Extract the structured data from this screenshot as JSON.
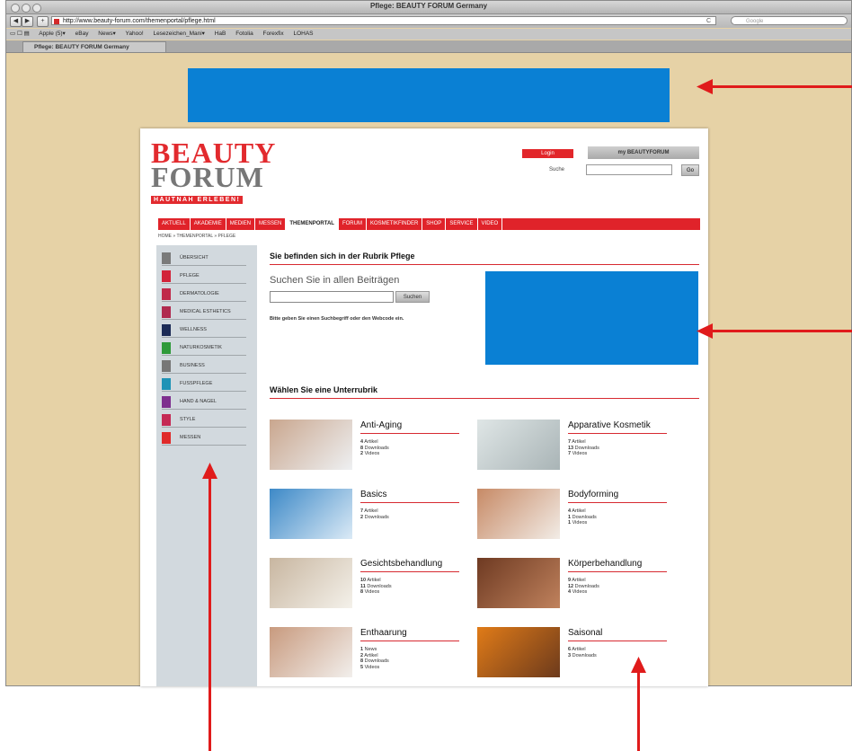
{
  "browser": {
    "window_title": "Pflege: BEAUTY FORUM Germany",
    "url": "http://www.beauty-forum.com/themenportal/pflege.html",
    "search_placeholder": "Google",
    "reload_glyph": "C",
    "bookmarks": [
      "Apple (5)▾",
      "eBay",
      "News▾",
      "Yahoo!",
      "Lesezeichen_Mani▾",
      "HaB",
      "Fotolia",
      "Forexfix",
      "LOHAS"
    ],
    "tab_title": "Pflege: BEAUTY FORUM Germany"
  },
  "header": {
    "logo_line1": "BEAUTY",
    "logo_line2": "FORUM",
    "logo_tagline": "HAUTNAH ERLEBEN!",
    "login_label": "Login",
    "my_label": "my BEAUTYFORUM",
    "search_label": "Suche",
    "go_label": "Go"
  },
  "nav": {
    "items": [
      "AKTUELL",
      "AKADEMIE",
      "MEDIEN",
      "MESSEN",
      "THEMENPORTAL",
      "FORUM",
      "KOSMETIKFINDER",
      "SHOP",
      "SERVICE",
      "VIDEO"
    ],
    "active": "THEMENPORTAL"
  },
  "breadcrumb": "HOME » THEMENPORTAL » PFLEGE",
  "sidebar": {
    "items": [
      {
        "label": "ÜBERSICHT",
        "color": "#7a7a7a"
      },
      {
        "label": "PFLEGE",
        "color": "#d2243a"
      },
      {
        "label": "DERMATOLOGIE",
        "color": "#c02a4a"
      },
      {
        "label": "MEDICAL ESTHETICS",
        "color": "#b02a4f"
      },
      {
        "label": "WELLNESS",
        "color": "#1c2b56"
      },
      {
        "label": "NATURKOSMETIK",
        "color": "#2f9a3a"
      },
      {
        "label": "BUSINESS",
        "color": "#777777"
      },
      {
        "label": "FUSSPFLEGE",
        "color": "#1f93b6"
      },
      {
        "label": "HAND & NAGEL",
        "color": "#7e2f8e"
      },
      {
        "label": "STYLE",
        "color": "#c52a55"
      },
      {
        "label": "MESSEN",
        "color": "#e02a2a"
      }
    ]
  },
  "main": {
    "rubrik_title": "Sie befinden sich in der Rubrik Pflege",
    "search_heading": "Suchen Sie in allen Beiträgen",
    "search_button": "Suchen",
    "search_hint": "Bitte geben Sie einen Suchbegriff oder den Webcode ein.",
    "unterrubrik_title": "Wählen Sie eine Unterrubrik"
  },
  "categories": [
    {
      "title": "Anti-Aging",
      "stats": [
        [
          "4",
          "Artikel"
        ],
        [
          "8",
          "Downloads"
        ],
        [
          "2",
          "Videos"
        ]
      ],
      "img": [
        "#c9a68e",
        "#eef0f2"
      ]
    },
    {
      "title": "Apparative Kosmetik",
      "stats": [
        [
          "7",
          "Artikel"
        ],
        [
          "13",
          "Downloads"
        ],
        [
          "7",
          "Videos"
        ]
      ],
      "img": [
        "#dfe6e6",
        "#a9b4b6"
      ]
    },
    {
      "title": "Basics",
      "stats": [
        [
          "7",
          "Artikel"
        ],
        [
          "2",
          "Downloads"
        ]
      ],
      "img": [
        "#3d89c7",
        "#dbeaf6"
      ]
    },
    {
      "title": "Bodyforming",
      "stats": [
        [
          "4",
          "Artikel"
        ],
        [
          "1",
          "Downloads"
        ],
        [
          "1",
          "Videos"
        ]
      ],
      "img": [
        "#c78a66",
        "#f2ece6"
      ]
    },
    {
      "title": "Gesichtsbehandlung",
      "stats": [
        [
          "10",
          "Artikel"
        ],
        [
          "11",
          "Downloads"
        ],
        [
          "8",
          "Videos"
        ]
      ],
      "img": [
        "#c8b6a0",
        "#f4f1ea"
      ]
    },
    {
      "title": "Körperbehandlung",
      "stats": [
        [
          "9",
          "Artikel"
        ],
        [
          "12",
          "Downloads"
        ],
        [
          "4",
          "Videos"
        ]
      ],
      "img": [
        "#6e3a22",
        "#c0825d"
      ]
    },
    {
      "title": "Enthaarung",
      "stats": [
        [
          "1",
          "News"
        ],
        [
          "2",
          "Artikel"
        ],
        [
          "8",
          "Downloads"
        ],
        [
          "5",
          "Videos"
        ]
      ],
      "img": [
        "#c89a7e",
        "#f2efec"
      ]
    },
    {
      "title": "Saisonal",
      "stats": [
        [
          "6",
          "Artikel"
        ],
        [
          "3",
          "Downloads"
        ]
      ],
      "img": [
        "#e07b18",
        "#6c3a1c"
      ]
    }
  ],
  "colors": {
    "ad_blue": "#0a80d4",
    "brand_red": "#e22a2e",
    "arrow_red": "#e01b1b",
    "wall": "#e6d2a6"
  }
}
